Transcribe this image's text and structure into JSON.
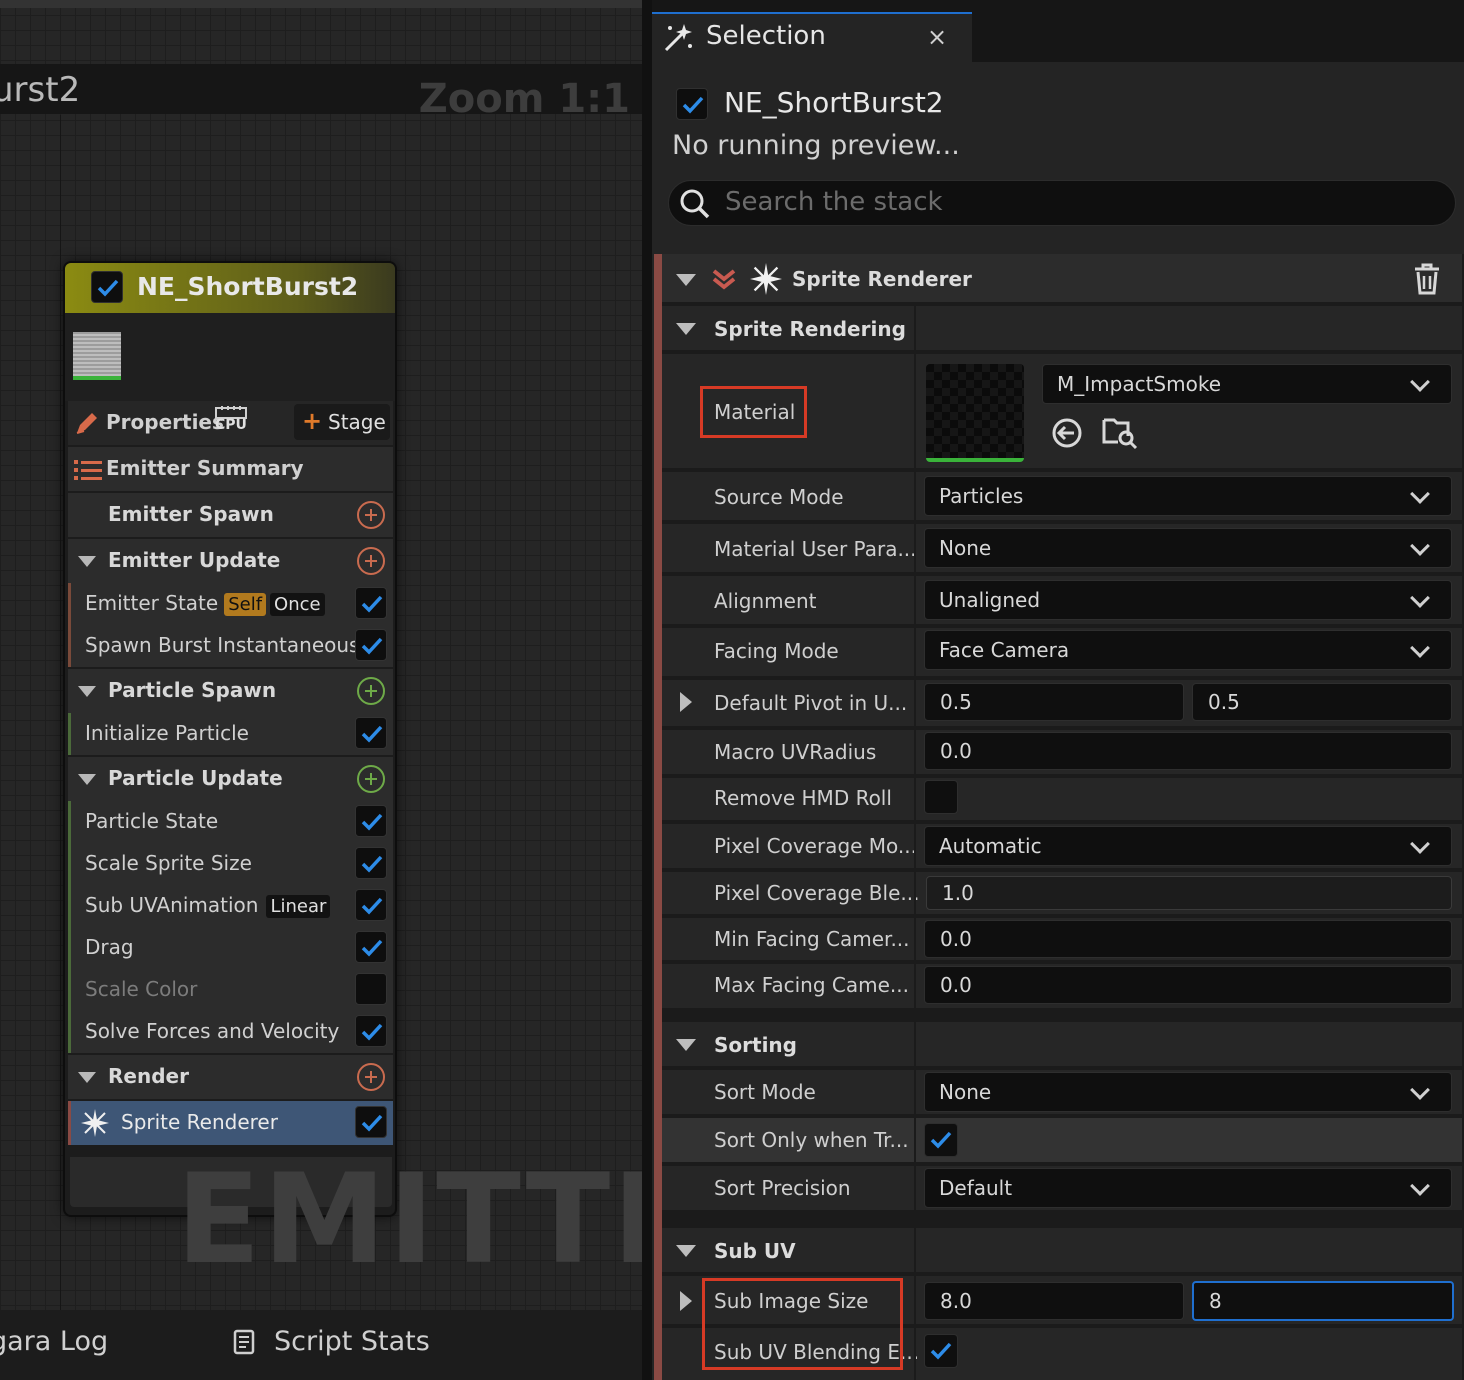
{
  "graph": {
    "title": "urst2",
    "zoom": "Zoom 1:1",
    "watermark": "EMITTER"
  },
  "node": {
    "title": "NE_ShortBurst2",
    "properties_label": "Properties",
    "cpu_label": "CPU",
    "stage_label": "Stage",
    "emitter_summary": "Emitter Summary",
    "emitter_spawn": "Emitter Spawn",
    "emitter_update": "Emitter Update",
    "emitter_state": "Emitter State",
    "emitter_state_tag1": "Self",
    "emitter_state_tag2": "Once",
    "spawn_burst": "Spawn Burst Instantaneous",
    "particle_spawn": "Particle Spawn",
    "initialize_particle": "Initialize Particle",
    "particle_update": "Particle Update",
    "particle_state": "Particle State",
    "scale_sprite_size": "Scale Sprite Size",
    "sub_uv_animation": "Sub UVAnimation",
    "sub_uv_tag": "Linear",
    "drag": "Drag",
    "scale_color": "Scale Color",
    "solve_forces": "Solve Forces and Velocity",
    "render": "Render",
    "sprite_renderer": "Sprite Renderer"
  },
  "bottom_tabs": {
    "log": "gara Log",
    "stats": "Script Stats"
  },
  "panel": {
    "tab_title": "Selection",
    "close": "×",
    "selected_name": "NE_ShortBurst2",
    "no_preview": "No running preview...",
    "search_placeholder": "Search the stack",
    "renderer_title": "Sprite Renderer",
    "sections": {
      "sprite_rendering": "Sprite Rendering",
      "sorting": "Sorting",
      "sub_uv": "Sub UV"
    },
    "props": {
      "material": "Material",
      "material_value": "M_ImpactSmoke",
      "source_mode": "Source Mode",
      "source_mode_value": "Particles",
      "material_user_param": "Material User Para...",
      "material_user_param_value": "None",
      "alignment": "Alignment",
      "alignment_value": "Unaligned",
      "facing_mode": "Facing Mode",
      "facing_mode_value": "Face Camera",
      "default_pivot": "Default Pivot in U...",
      "default_pivot_x": "0.5",
      "default_pivot_y": "0.5",
      "macro_uv_radius": "Macro UVRadius",
      "macro_uv_radius_value": "0.0",
      "remove_hmd_roll": "Remove HMD Roll",
      "pixel_coverage_mode": "Pixel Coverage Mo...",
      "pixel_coverage_mode_value": "Automatic",
      "pixel_coverage_blend": "Pixel Coverage Ble...",
      "pixel_coverage_blend_value": "1.0",
      "min_facing": "Min Facing Camer...",
      "min_facing_value": "0.0",
      "max_facing": "Max Facing Came...",
      "max_facing_value": "0.0",
      "sort_mode": "Sort Mode",
      "sort_mode_value": "None",
      "sort_only_when": "Sort Only when Tr...",
      "sort_precision": "Sort Precision",
      "sort_precision_value": "Default",
      "sub_image_size": "Sub Image Size",
      "sub_image_size_x": "8.0",
      "sub_image_size_y": "8",
      "sub_uv_blending": "Sub UV Blending E..."
    }
  },
  "colors": {
    "accent_blue": "#1f6fcf",
    "highlight_red": "#d63a25",
    "node_header_yellow": "#8b8b12"
  }
}
